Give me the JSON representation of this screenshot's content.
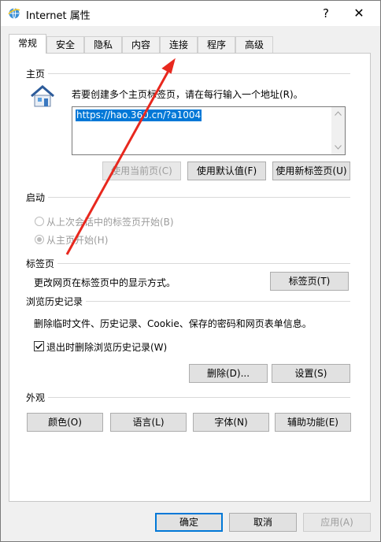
{
  "window": {
    "title": "Internet 属性",
    "help": "?",
    "close": "✕"
  },
  "tabs": [
    {
      "label": "常规",
      "active": true
    },
    {
      "label": "安全"
    },
    {
      "label": "隐私"
    },
    {
      "label": "内容"
    },
    {
      "label": "连接"
    },
    {
      "label": "程序"
    },
    {
      "label": "高级"
    }
  ],
  "homepage": {
    "title": "主页",
    "instruction": "若要创建多个主页标签页，请在每行输入一个地址(R)。",
    "url": "https://hao.360.cn/?a1004",
    "buttons": {
      "use_current": "使用当前页(C)",
      "use_default": "使用默认值(F)",
      "use_new_tab": "使用新标签页(U)"
    }
  },
  "startup": {
    "title": "启动",
    "option_last_session": "从上次会话中的标签页开始(B)",
    "option_homepage": "从主页开始(H)"
  },
  "tabs_section": {
    "title": "标签页",
    "description": "更改网页在标签页中的显示方式。",
    "button": "标签页(T)"
  },
  "history": {
    "title": "浏览历史记录",
    "description": "删除临时文件、历史记录、Cookie、保存的密码和网页表单信息。",
    "checkbox_label": "退出时删除浏览历史记录(W)",
    "checkbox_checked": true,
    "delete_button": "删除(D)...",
    "settings_button": "设置(S)"
  },
  "appearance": {
    "title": "外观",
    "buttons": {
      "colors": "颜色(O)",
      "languages": "语言(L)",
      "fonts": "字体(N)",
      "accessibility": "辅助功能(E)"
    }
  },
  "footer": {
    "ok": "确定",
    "cancel": "取消",
    "apply": "应用(A)"
  },
  "colors": {
    "accent": "#0078d7",
    "annotation_arrow": "#e8281e"
  },
  "icons": {
    "app": "ie-globe-icon",
    "home": "house-icon"
  }
}
